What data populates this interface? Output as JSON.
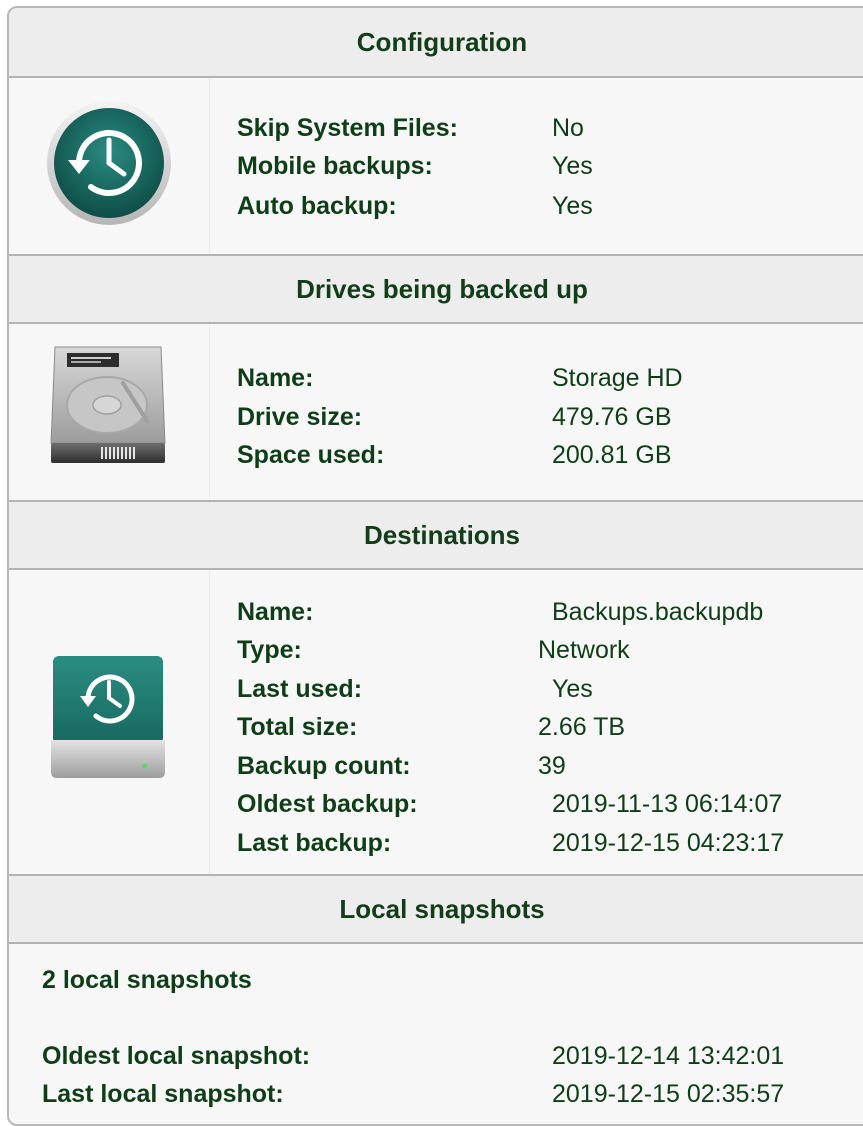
{
  "configuration": {
    "title": "Configuration",
    "icon": "time-machine-icon",
    "rows": [
      {
        "label": "Skip System Files:",
        "value": "No"
      },
      {
        "label": "Mobile backups:",
        "value": "Yes"
      },
      {
        "label": "Auto backup:",
        "value": "Yes"
      }
    ]
  },
  "drives": {
    "title": "Drives being backed up",
    "icon": "hard-drive-icon",
    "rows": [
      {
        "label": "Name:",
        "value": "Storage HD"
      },
      {
        "label": "Drive size:",
        "value": "479.76 GB"
      },
      {
        "label": "Space used:",
        "value": "200.81 GB"
      }
    ]
  },
  "destinations": {
    "title": "Destinations",
    "icon": "time-machine-drive-icon",
    "rows": [
      {
        "label": "Name:",
        "value": "Backups.backupdb"
      },
      {
        "label": "Type:",
        "value": "Network"
      },
      {
        "label": "Last used:",
        "value": "Yes"
      },
      {
        "label": "Total size:",
        "value": "2.66 TB"
      },
      {
        "label": "Backup count:",
        "value": "39"
      },
      {
        "label": "Oldest backup:",
        "value": "2019-11-13 06:14:07"
      },
      {
        "label": "Last backup:",
        "value": "2019-12-15 04:23:17"
      }
    ]
  },
  "snapshots": {
    "title": "Local snapshots",
    "summary": "2 local snapshots",
    "rows": [
      {
        "label": "Oldest local snapshot:",
        "value": "2019-12-14 13:42:01"
      },
      {
        "label": "Last local snapshot:",
        "value": "2019-12-15 02:35:57"
      }
    ]
  },
  "colors": {
    "text": "#123d18",
    "header_bg": "#ededed",
    "panel_bg": "#f7f7f7",
    "accent_teal": "#1b7f73"
  }
}
